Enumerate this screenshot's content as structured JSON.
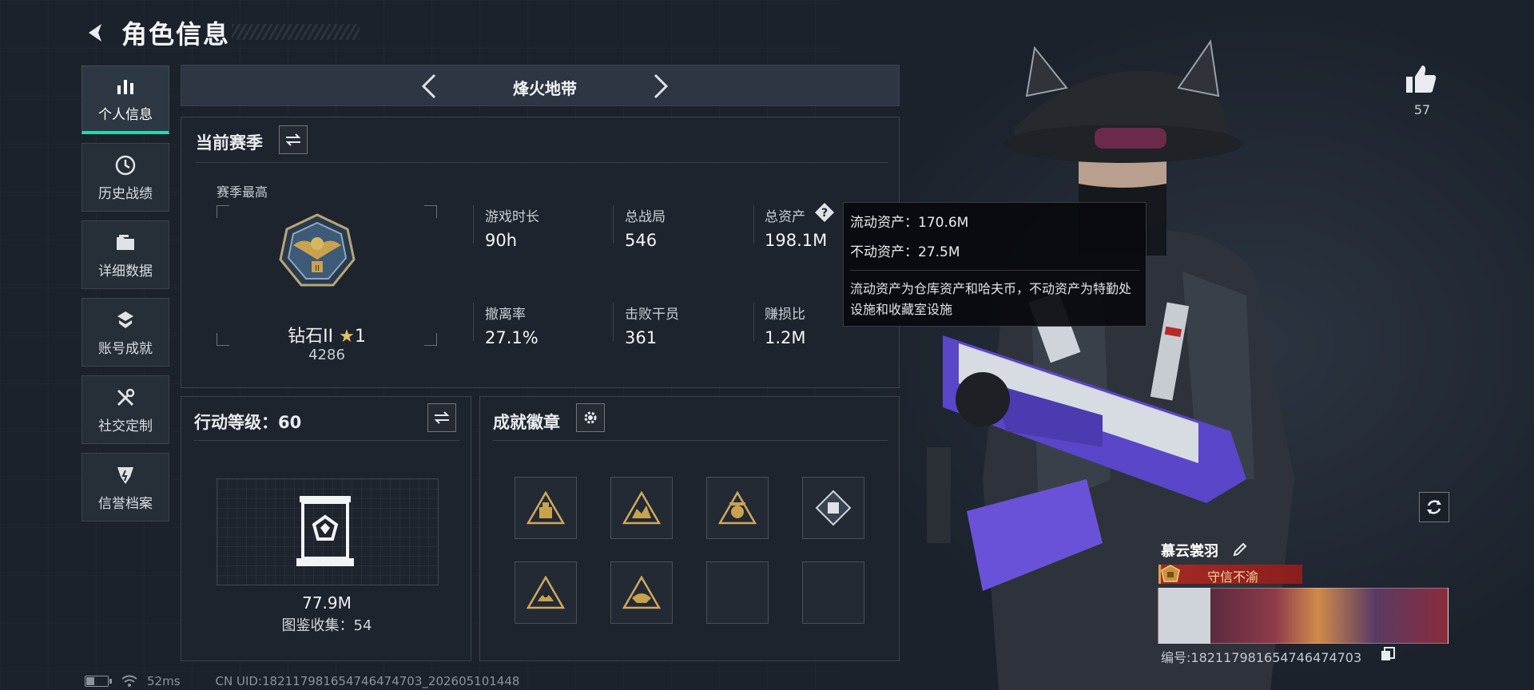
{
  "header": {
    "title": "角色信息"
  },
  "sidebar": {
    "items": [
      {
        "label": "个人信息",
        "icon": "stats-icon",
        "active": true
      },
      {
        "label": "历史战绩",
        "icon": "history-icon",
        "active": false
      },
      {
        "label": "详细数据",
        "icon": "folder-icon",
        "active": false
      },
      {
        "label": "账号成就",
        "icon": "achievement-icon",
        "active": false
      },
      {
        "label": "社交定制",
        "icon": "tools-icon",
        "active": false
      },
      {
        "label": "信誉档案",
        "icon": "shield-icon",
        "active": false
      }
    ]
  },
  "mode": {
    "name": "烽火地带"
  },
  "season": {
    "title": "当前赛季",
    "best_label": "赛季最高",
    "rank_name": "钻石II",
    "rank_star_icon": "★",
    "rank_stars": "1",
    "rank_score": "4286",
    "stats": [
      {
        "label": "游戏时长",
        "value": "90h"
      },
      {
        "label": "总战局",
        "value": "546"
      },
      {
        "label": "总资产",
        "value": "198.1M"
      },
      {
        "label": "撤离率",
        "value": "27.1%"
      },
      {
        "label": "击败干员",
        "value": "361"
      },
      {
        "label": "赚损比",
        "value": "1.2M"
      }
    ]
  },
  "tooltip": {
    "liquid": "流动资产：170.6M",
    "fixed": "不动资产：27.5M",
    "desc": "流动资产为仓库资产和哈夫币，不动资产为特勤处设施和收藏室设施"
  },
  "level": {
    "title": "行动等级：60",
    "collection_value": "77.9M",
    "collection_count": "图鉴收集：54"
  },
  "badges": {
    "title": "成就徽章",
    "slots": 8,
    "filled": 6
  },
  "likes": {
    "count": "57"
  },
  "player": {
    "name": "慕云裳羽",
    "title": "守信不渝",
    "id": "编号:1821179816547464747​03"
  },
  "status": {
    "battery": 0.35,
    "latency": "52ms",
    "uid": "CN UID:1821179816547464747​03_202605101448"
  },
  "colors": {
    "accent": "#2bd6b0",
    "gold": "#d6a74a",
    "tooltip_bg": "#0a0c10"
  }
}
